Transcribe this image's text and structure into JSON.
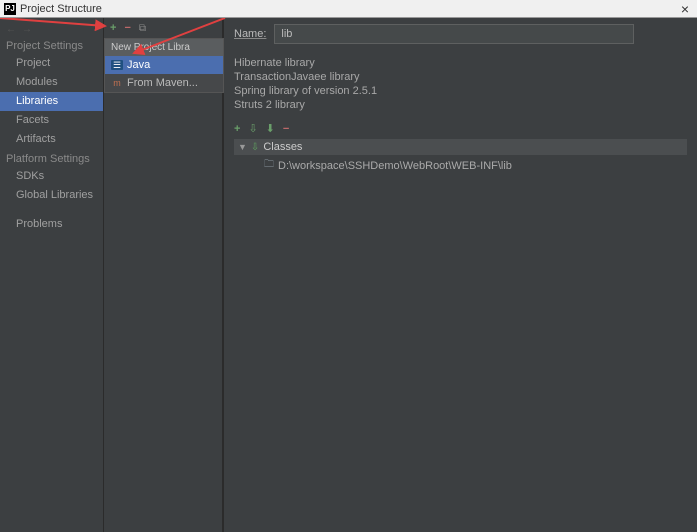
{
  "window": {
    "title": "Project Structure",
    "icon_char": "PJ"
  },
  "sidebar": {
    "sections": [
      {
        "header": "Project Settings",
        "items": [
          {
            "label": "Project",
            "sel": false
          },
          {
            "label": "Modules",
            "sel": false
          },
          {
            "label": "Libraries",
            "sel": true
          },
          {
            "label": "Facets",
            "sel": false
          },
          {
            "label": "Artifacts",
            "sel": false
          }
        ]
      },
      {
        "header": "Platform Settings",
        "items": [
          {
            "label": "SDKs",
            "sel": false
          },
          {
            "label": "Global Libraries",
            "sel": false
          }
        ]
      },
      {
        "header": "",
        "items": [
          {
            "label": "Problems",
            "sel": false
          }
        ]
      }
    ]
  },
  "popup": {
    "header": "New Project Libra",
    "items": [
      {
        "label": "Java",
        "kind": "java",
        "hl": true
      },
      {
        "label": "From Maven...",
        "kind": "maven",
        "hl": false
      }
    ]
  },
  "right": {
    "name_label": "Name:",
    "name_value": "lib",
    "libraries": [
      "Hibernate library",
      "TransactionJavaee library",
      "Spring library of version 2.5.1",
      "Struts 2 library"
    ],
    "tree_root": "Classes",
    "tree_path": "D:\\workspace\\SSHDemo\\WebRoot\\WEB-INF\\lib"
  }
}
